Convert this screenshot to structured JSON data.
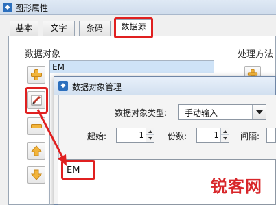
{
  "window": {
    "title": "图形属性"
  },
  "tabs": [
    {
      "label": "基本"
    },
    {
      "label": "文字"
    },
    {
      "label": "条码"
    },
    {
      "label": "数据源"
    }
  ],
  "data_source": {
    "group_label": "数据对象",
    "items": [
      "EM"
    ],
    "process_label": "处理方法"
  },
  "dialog": {
    "title": "数据对象管理",
    "type_label": "数据对象类型:",
    "type_value": "手动输入",
    "start_label": "起始:",
    "start_value": "1",
    "copies_label": "份数:",
    "copies_value": "1",
    "interval_label": "间隔:",
    "content_value": "EM"
  },
  "watermark": {
    "text": "锐客网"
  },
  "colors": {
    "highlight": "#e02020",
    "titlebar": "#d2e0f0",
    "selection": "#cfe3f7",
    "brand": "#2c6fbd"
  },
  "icons": [
    "app-icon",
    "add-icon",
    "edit-icon",
    "remove-icon",
    "move-up-icon",
    "move-down-icon",
    "dropdown-arrow-icon"
  ]
}
